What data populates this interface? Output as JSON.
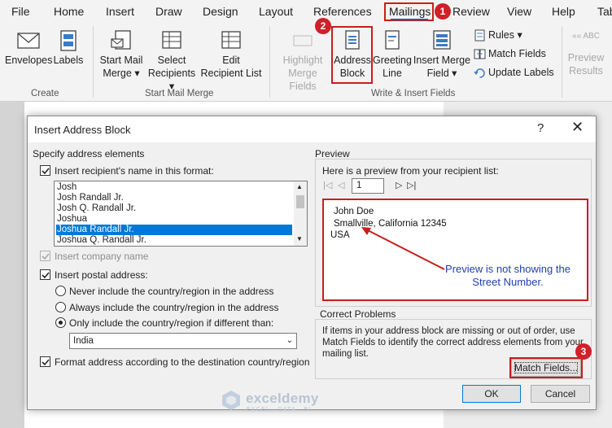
{
  "menu": {
    "tabs": [
      "File",
      "Home",
      "Insert",
      "Draw",
      "Design",
      "Layout",
      "References",
      "Mailings",
      "Review",
      "View",
      "Help",
      "Tab"
    ],
    "active_tab": "Mailings"
  },
  "ribbon": {
    "create_group": {
      "label": "Create",
      "envelopes": "Envelopes",
      "labels": "Labels"
    },
    "start_group": {
      "label": "Start Mail Merge",
      "start_mail_merge_1": "Start Mail",
      "start_mail_merge_2": "Merge",
      "select_recipients_1": "Select",
      "select_recipients_2": "Recipients",
      "edit_list_1": "Edit",
      "edit_list_2": "Recipient List"
    },
    "write_group": {
      "label": "Write & Insert Fields",
      "highlight_1": "Highlight",
      "highlight_2": "Merge Fields",
      "address_block_1": "Address",
      "address_block_2": "Block",
      "greeting_line_1": "Greeting",
      "greeting_line_2": "Line",
      "insert_merge_field_1": "Insert Merge",
      "insert_merge_field_2": "Field",
      "rules": "Rules",
      "match_fields": "Match Fields",
      "update_labels": "Update Labels"
    },
    "preview_group": {
      "abc": "ABC",
      "preview_1": "Preview",
      "preview_2": "Results"
    }
  },
  "badges": {
    "one": "1",
    "two": "2",
    "three": "3"
  },
  "dialog": {
    "title": "Insert Address Block",
    "help": "?",
    "close": "✕",
    "specify_label": "Specify address elements",
    "insert_name_label": "Insert recipient's name in this format:",
    "name_formats": [
      "Josh",
      "Josh Randall Jr.",
      "Josh Q. Randall Jr.",
      "Joshua",
      "Joshua Randall Jr.",
      "Joshua Q. Randall Jr."
    ],
    "selected_format": "Joshua Randall Jr.",
    "insert_company_label": "Insert company name",
    "insert_postal_label": "Insert postal address:",
    "radio_never": "Never include the country/region in the address",
    "radio_always": "Always include the country/region in the address",
    "radio_only": "Only include the country/region if different than:",
    "country_value": "India",
    "format_address_label": "Format address according to the destination country/region",
    "preview_label": "Preview",
    "preview_intro": "Here is a preview from your recipient list:",
    "record_number": "1",
    "address_lines": [
      "John Doe",
      "Smallville,  California 12345",
      "USA"
    ],
    "annotation_1": "Preview is not showing the",
    "annotation_2": "Street Number.",
    "correct_problems_label": "Correct Problems",
    "correct_problems_text": "If items in your address block are missing or out of order, use Match Fields to identify the correct address elements from your mailing list.",
    "match_fields_button": "Match Fields...",
    "ok_button": "OK",
    "cancel_button": "Cancel"
  },
  "watermark": {
    "name": "exceldemy",
    "subtitle": "EXCEL · DATA · BI"
  }
}
